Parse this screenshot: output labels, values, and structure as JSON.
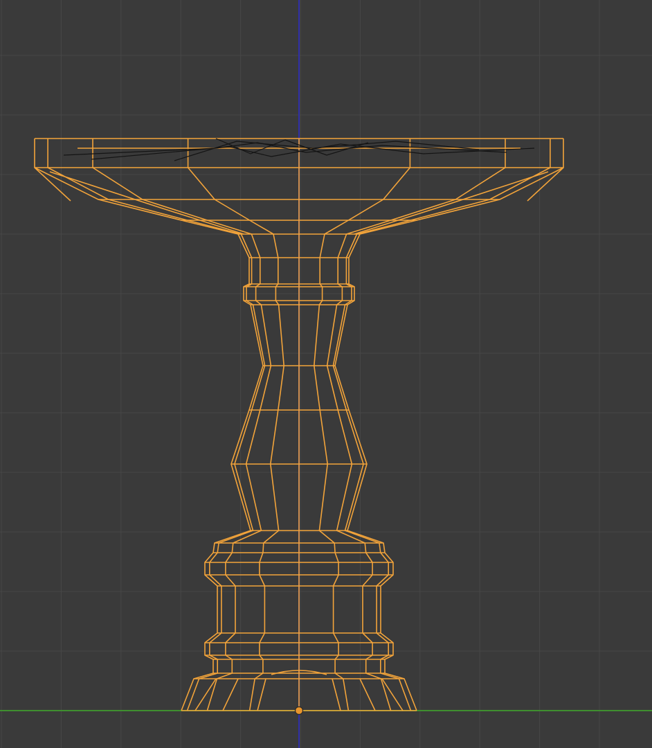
{
  "viewport": {
    "background_color": "#3a3a3a",
    "grid_color": "#474747",
    "z_axis_color": "#2f2fa8",
    "x_axis_color": "#3f8f2f",
    "wire_color": "#f3a43a",
    "dark_edge_color": "#141414",
    "origin_color": "#e8942c",
    "object_icon": "wireframe-mesh-icon"
  }
}
